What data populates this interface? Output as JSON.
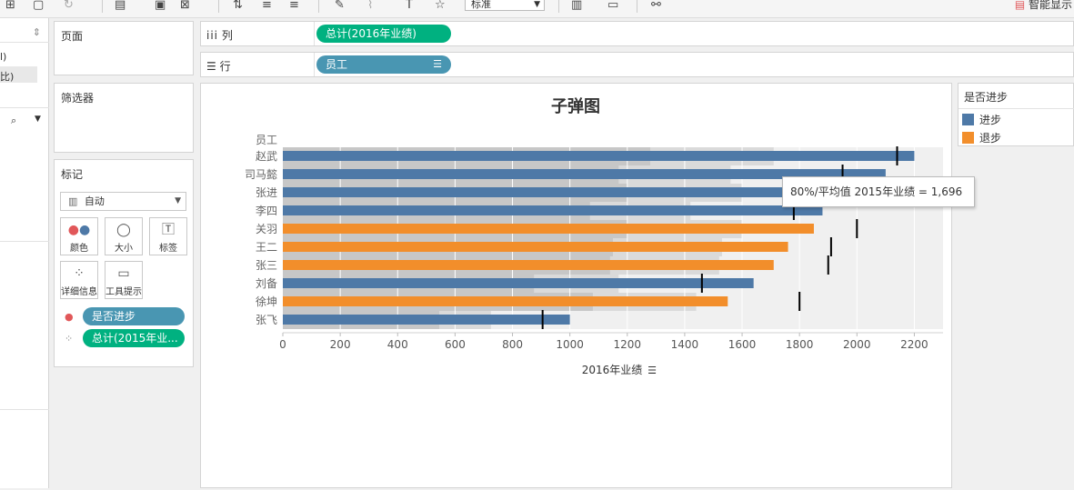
{
  "toolbar": {
    "fit_value": "标准",
    "right_label": "智能显示"
  },
  "left_pane": {
    "row1": "l)",
    "row2": "比)"
  },
  "pages_card": {
    "title": "页面"
  },
  "filters_card": {
    "title": "筛选器"
  },
  "marks_card": {
    "title": "标记",
    "type_value": "自动",
    "buttons": {
      "color": "颜色",
      "size": "大小",
      "label": "标签",
      "detail": "详细信息",
      "tooltip": "工具提示"
    },
    "fields": {
      "color_field": "是否进步",
      "detail_field": "总计(2015年业..."
    }
  },
  "columns_shelf": {
    "label": "列",
    "pill": "总计(2016年业绩)"
  },
  "rows_shelf": {
    "label": "行",
    "pill": "员工"
  },
  "legend": {
    "title": "是否进步",
    "items": [
      {
        "label": "进步",
        "color": "#4e79a7"
      },
      {
        "label": "退步",
        "color": "#f28e2b"
      }
    ]
  },
  "tooltip": {
    "text": "80%/平均值 2015年业绩 = 1,696"
  },
  "chart_data": {
    "type": "bar",
    "title": "子弹图",
    "row_header": "员工",
    "xlabel": "2016年业绩",
    "xlim": [
      0,
      2300
    ],
    "xticks": [
      0,
      200,
      400,
      600,
      800,
      1000,
      1200,
      1400,
      1600,
      1800,
      2000,
      2200
    ],
    "grid": true,
    "categories": [
      "赵武",
      "司马懿",
      "张进",
      "李四",
      "关羽",
      "王二",
      "张三",
      "刘备",
      "徐坤",
      "张飞"
    ],
    "series": [
      {
        "name": "2016年业绩",
        "values": [
          2200,
          2100,
          1950,
          1880,
          1850,
          1760,
          1710,
          1640,
          1550,
          1000
        ]
      }
    ],
    "status": [
      "进步",
      "进步",
      "进步",
      "进步",
      "退步",
      "退步",
      "退步",
      "进步",
      "退步",
      "进步"
    ],
    "reference_2015": [
      2140,
      1950,
      1900,
      1780,
      2000,
      1910,
      1900,
      1460,
      1800,
      905
    ],
    "band_60pct": [
      1280,
      1170,
      1200,
      1070,
      1200,
      1150,
      1140,
      875,
      1080,
      545
    ],
    "band_80pct": [
      1710,
      1560,
      1600,
      1420,
      1600,
      1530,
      1520,
      1170,
      1440,
      725
    ],
    "colors": {
      "进步": "#4e79a7",
      "退步": "#f28e2b"
    }
  }
}
